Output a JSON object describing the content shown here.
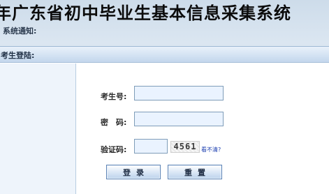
{
  "banner": {
    "title": "年广东省初中毕业生基本信息采集系统"
  },
  "panel": {
    "header": "考生登陆:"
  },
  "notice": {
    "label": "系统通知:"
  },
  "form": {
    "student_id_label": "考生号:",
    "student_id_value": "",
    "password_label": "密　码:",
    "password_value": "",
    "captcha_label": "验证码:",
    "captcha_value": "",
    "captcha_image_text": "4561",
    "refresh_link": "看不清?"
  },
  "buttons": {
    "login": "登录",
    "reset": "重置"
  },
  "colors": {
    "background": "#dbe6f1",
    "header_gradient": "#c3d6ec",
    "input_background": "#eaf3ff",
    "link": "#1c3fb0"
  }
}
